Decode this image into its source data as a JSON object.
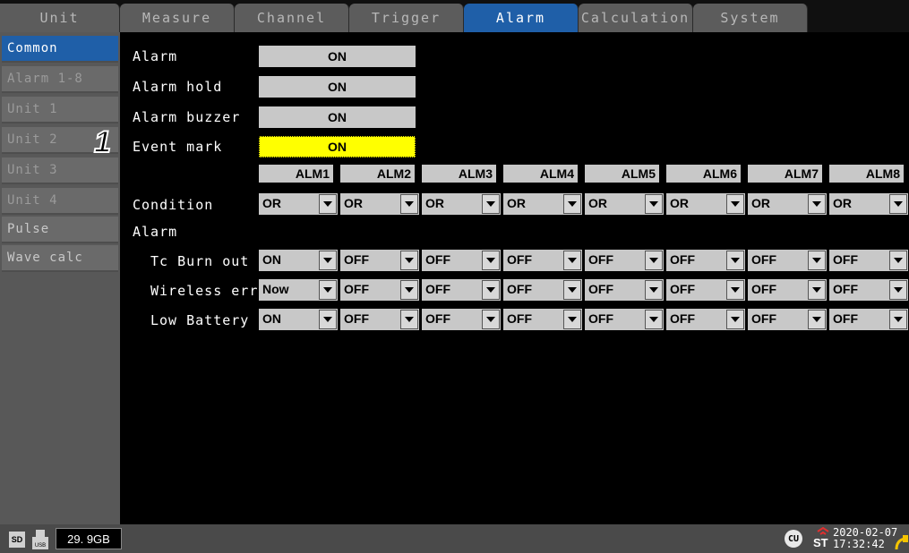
{
  "tabs": [
    {
      "label": "Unit"
    },
    {
      "label": "Measure"
    },
    {
      "label": "Channel"
    },
    {
      "label": "Trigger"
    },
    {
      "label": "Alarm"
    },
    {
      "label": "Calculation"
    },
    {
      "label": "System"
    }
  ],
  "sidebar": {
    "items": [
      {
        "label": "Common"
      },
      {
        "label": "Alarm 1-8"
      },
      {
        "label": "Unit 1"
      },
      {
        "label": "Unit 2"
      },
      {
        "label": "Unit 3"
      },
      {
        "label": "Unit 4"
      },
      {
        "label": "Pulse"
      },
      {
        "label": "Wave calc"
      }
    ]
  },
  "settings": {
    "alarm_label": "Alarm",
    "alarm_value": "ON",
    "alarm_hold_label": "Alarm hold",
    "alarm_hold_value": "ON",
    "alarm_buzzer_label": "Alarm buzzer",
    "alarm_buzzer_value": "ON",
    "event_mark_label": "Event mark",
    "event_mark_value": "ON"
  },
  "callout_number": "1",
  "grid": {
    "columns": [
      "ALM1",
      "ALM2",
      "ALM3",
      "ALM4",
      "ALM5",
      "ALM6",
      "ALM7",
      "ALM8"
    ],
    "condition_label": "Condition",
    "condition_values": [
      "OR",
      "OR",
      "OR",
      "OR",
      "OR",
      "OR",
      "OR",
      "OR"
    ],
    "alarm_section_label": "Alarm",
    "tc_burn_out_label": "Tc Burn out",
    "tc_burn_out_values": [
      "ON",
      "OFF",
      "OFF",
      "OFF",
      "OFF",
      "OFF",
      "OFF",
      "OFF"
    ],
    "wireless_err_label": "Wireless err",
    "wireless_err_values": [
      "Now",
      "OFF",
      "OFF",
      "OFF",
      "OFF",
      "OFF",
      "OFF",
      "OFF"
    ],
    "low_battery_label": "Low Battery",
    "low_battery_values": [
      "ON",
      "OFF",
      "OFF",
      "OFF",
      "OFF",
      "OFF",
      "OFF",
      "OFF"
    ]
  },
  "status": {
    "sd_label": "SD",
    "usb_label": "USB",
    "capacity": "29. 9GB",
    "cu_label": "CU",
    "st_label": "ST",
    "date": "2020-02-07",
    "time": "17:32:42"
  },
  "colors": {
    "active_tab": "#1f5fa8",
    "highlight": "#ffff00",
    "field_bg": "#c8c8c8"
  }
}
